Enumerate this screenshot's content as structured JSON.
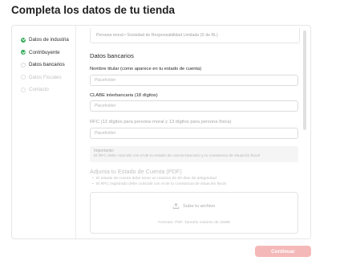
{
  "page": {
    "title": "Completa los datos de tu tienda"
  },
  "steps": [
    {
      "label": "Datos de industria",
      "state": "done"
    },
    {
      "label": "Contribuyente",
      "state": "done"
    },
    {
      "label": "Datos bancarios",
      "state": "current"
    },
    {
      "label": "Datos Fiscales",
      "state": "todo"
    },
    {
      "label": "Contacto",
      "state": "todo"
    }
  ],
  "prev_field": {
    "value": "Persona moral • Sociedad de Responsabilidad Limitada (S de RL)"
  },
  "bank": {
    "section_title": "Datos bancarios",
    "holder_label": "Nombre titular (como aparece en tu estado de cuenta)",
    "holder_placeholder": "Placeholder",
    "clabe_label": "CLABE interbancaria (18 dígitos)",
    "clabe_placeholder": "Placeholder",
    "rfc_label": "RFC (12 dígitos para persona moral y 13 dígitos para persona física)",
    "rfc_placeholder": "Placeholder"
  },
  "notice": {
    "title": "Importante:",
    "text": "El RFC debe coincidir con el de tu estado de cuenta bancario y tu constancia de situación fiscal"
  },
  "upload": {
    "title": "Adjunta tu Estado de Cuenta (PDF)",
    "requirements": [
      "El estado de cuenta debe tener un máximo de 60 días de antigüedad",
      "El RFC registrado debe coincidir con el de tu constancia de situación fiscal"
    ],
    "button_label": "Sube tu archivo",
    "format_text": "Formato: PDF. Tamaño máximo de 20MB"
  },
  "actions": {
    "continue_label": "Continuar"
  },
  "colors": {
    "success": "#2eaa55",
    "accent_disabled": "#f5b8b8"
  }
}
